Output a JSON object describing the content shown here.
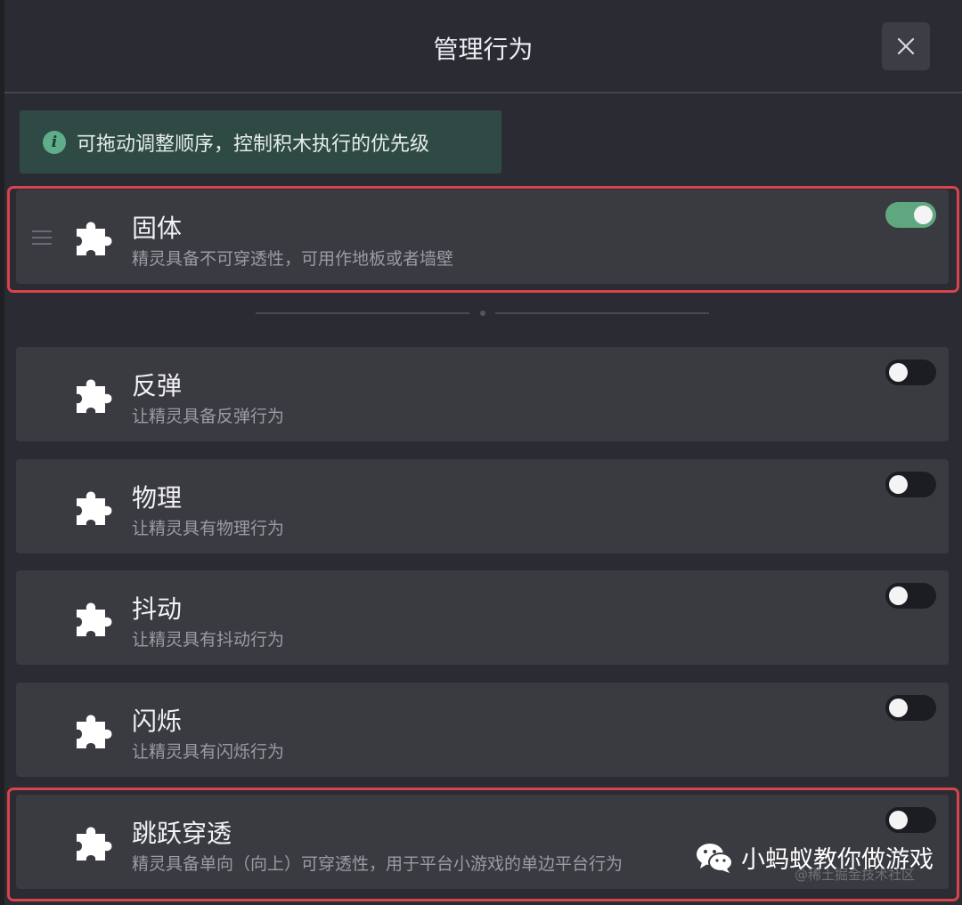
{
  "header": {
    "title": "管理行为"
  },
  "tip": {
    "text": "可拖动调整顺序，控制积木执行的优先级",
    "icon": "info-icon"
  },
  "behaviors": [
    {
      "name": "固体",
      "desc": "精灵具备不可穿透性，可用作地板或者墙壁",
      "enabled": true,
      "icon": "puzzle-icon"
    },
    {
      "name": "反弹",
      "desc": "让精灵具备反弹行为",
      "enabled": false,
      "icon": "puzzle-icon"
    },
    {
      "name": "物理",
      "desc": "让精灵具有物理行为",
      "enabled": false,
      "icon": "puzzle-icon"
    },
    {
      "name": "抖动",
      "desc": "让精灵具有抖动行为",
      "enabled": false,
      "icon": "puzzle-icon"
    },
    {
      "name": "闪烁",
      "desc": "让精灵具有闪烁行为",
      "enabled": false,
      "icon": "puzzle-icon"
    },
    {
      "name": "跳跃穿透",
      "desc": "精灵具备单向（向上）可穿透性，用于平台小游戏的单边平台行为",
      "enabled": false,
      "icon": "puzzle-icon"
    }
  ],
  "watermark": {
    "text": "小蚂蚁教你做游戏",
    "sub": "@稀土掘金技术社区"
  },
  "colors": {
    "accent": "#5fa87f",
    "highlight": "#d9434b",
    "tip_bg": "#2f4a44"
  }
}
